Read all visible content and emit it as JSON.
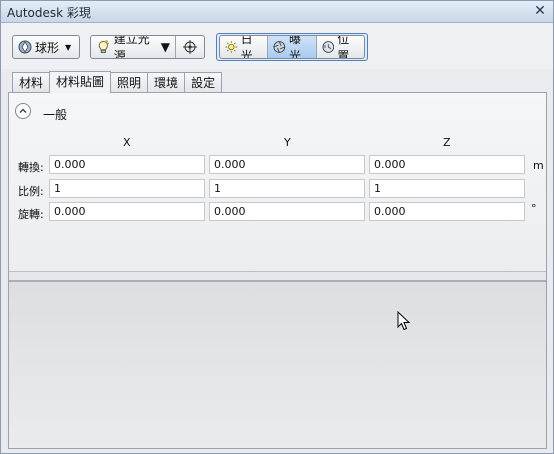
{
  "window": {
    "title": "Autodesk 彩現",
    "close_glyph": "✕"
  },
  "toolbar": {
    "sphere_button": "球形",
    "create_light_button": "建立光源",
    "sun_button": "日光",
    "exposure_button": "曝光",
    "location_button": "位置",
    "active_light_mode": "曝光"
  },
  "tabs": [
    {
      "label": "材料",
      "active": false
    },
    {
      "label": "材料貼圖",
      "active": true
    },
    {
      "label": "照明",
      "active": false
    },
    {
      "label": "環境",
      "active": false
    },
    {
      "label": "設定",
      "active": false
    }
  ],
  "section": {
    "title": "一般",
    "columns": [
      "X",
      "Y",
      "Z"
    ],
    "rows": [
      {
        "label": "轉換:",
        "values": [
          "0.000",
          "0.000",
          "0.000"
        ],
        "unit": "m"
      },
      {
        "label": "比例:",
        "values": [
          "1",
          "1",
          "1"
        ],
        "unit": ""
      },
      {
        "label": "旋轉:",
        "values": [
          "0.000",
          "0.000",
          "0.000"
        ],
        "unit": "°"
      }
    ]
  },
  "colors": {
    "accent": "#4f7fc4",
    "title_bar": "#c9d6e8",
    "panel": "#e4e6e9"
  }
}
